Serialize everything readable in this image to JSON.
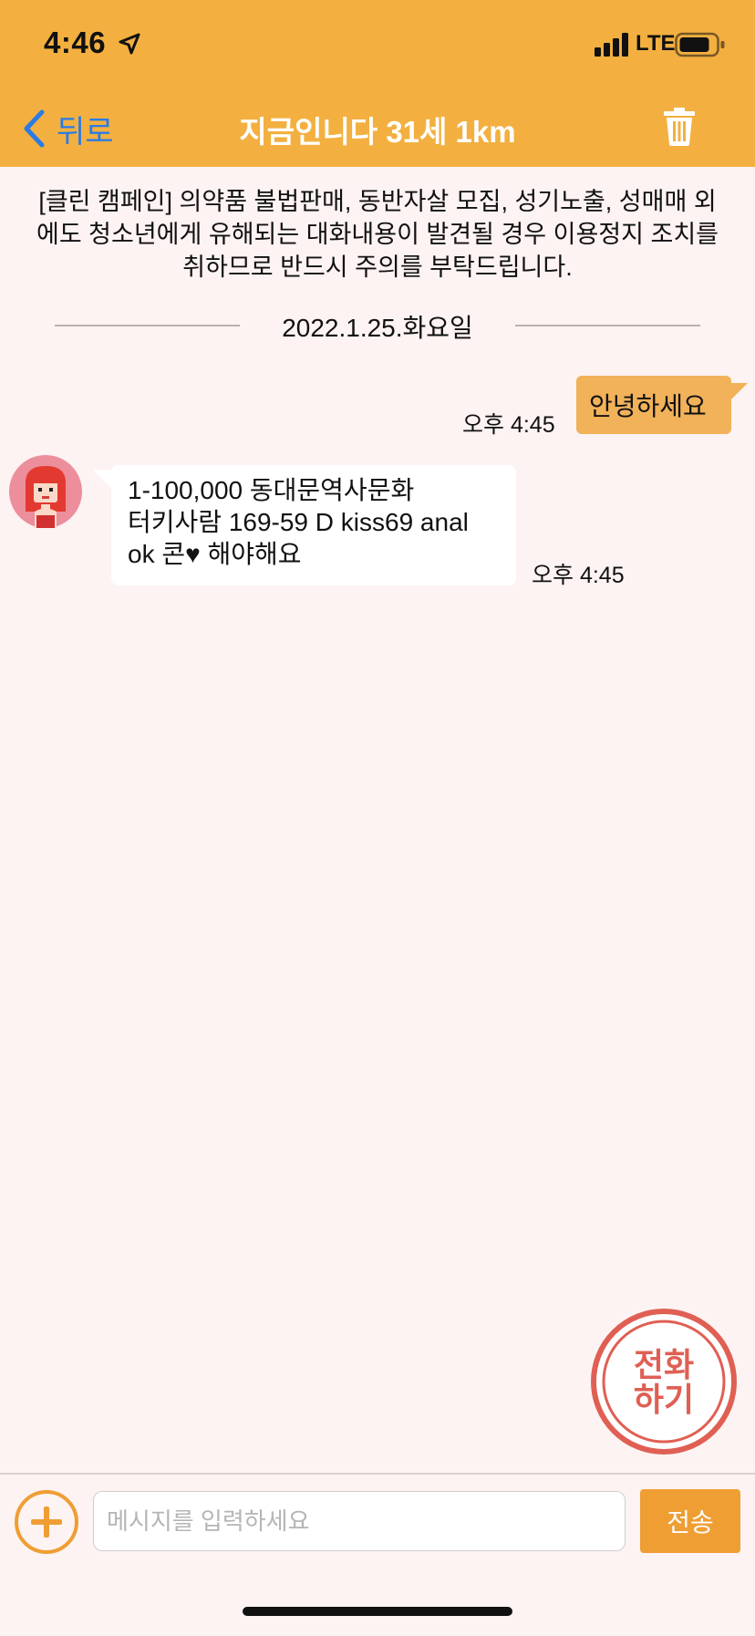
{
  "status_bar": {
    "time": "4:46",
    "network": "LTE",
    "location_icon": "location-arrow-icon",
    "signal_icon": "signal-bars-icon",
    "battery_icon": "battery-icon"
  },
  "nav": {
    "back_label": "뒤로",
    "title": "지금인니다 31세 1km",
    "back_icon": "chevron-left-icon",
    "delete_icon": "trash-icon"
  },
  "notice": "[클린 캠페인] 의약품 불법판매, 동반자살 모집, 성기노출, 성매매 외에도 청소년에게 유해되는 대화내용이 발견될 경우 이용정지 조치를 취하므로 반드시 주의를 부탁드립니다.",
  "date_divider": "2022.1.25.화요일",
  "messages": [
    {
      "direction": "outgoing",
      "text": "안녕하세요",
      "time": "오후 4:45"
    },
    {
      "direction": "incoming",
      "text": "1-100,000 동대문역사문화\n터키사람 169-59 D kiss69 anal\nok 콘♥ 해야해요",
      "time": "오후 4:45"
    }
  ],
  "call_button": {
    "label": "전화\n하기"
  },
  "composer": {
    "placeholder": "메시지를 입력하세요",
    "value": "",
    "send_label": "전송",
    "add_icon": "plus-circle-icon"
  },
  "colors": {
    "header": "#f3b040",
    "background": "#fcf3f2",
    "outgoing_bubble": "#f1b25a",
    "send_button": "#ef9e33",
    "call_button": "#e05f54",
    "back_link": "#2a7be6"
  }
}
